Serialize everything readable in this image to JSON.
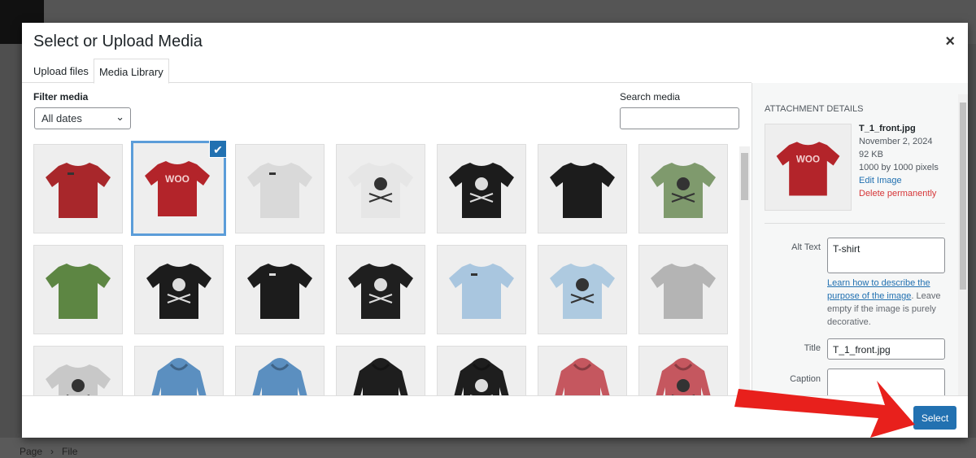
{
  "modal": {
    "title": "Select or Upload Media",
    "close": "×"
  },
  "tabs": [
    {
      "label": "Upload files"
    },
    {
      "label": "Media Library",
      "active": true
    }
  ],
  "filter": {
    "label": "Filter media",
    "value": "All dates"
  },
  "search": {
    "label": "Search media",
    "value": ""
  },
  "grid": [
    {
      "kind": "tee",
      "color": "#a8272b",
      "print": "logo"
    },
    {
      "kind": "tee",
      "color": "#b3242a",
      "print": "woo",
      "selected": true
    },
    {
      "kind": "tee",
      "color": "#d9d9d9",
      "print": "logo"
    },
    {
      "kind": "tee",
      "color": "#e6e6e6",
      "print": "skull"
    },
    {
      "kind": "tee",
      "color": "#1c1c1c",
      "print": "skull"
    },
    {
      "kind": "tee",
      "color": "#1c1c1c",
      "print": "none"
    },
    {
      "kind": "tee",
      "color": "#7f9a6d",
      "print": "skull"
    },
    {
      "kind": "tee",
      "color": "#5d8643",
      "print": "none"
    },
    {
      "kind": "tee",
      "color": "#1c1c1c",
      "print": "skull"
    },
    {
      "kind": "tee",
      "color": "#1c1c1c",
      "print": "logo"
    },
    {
      "kind": "tee",
      "color": "#1f1f1f",
      "print": "skull"
    },
    {
      "kind": "tee",
      "color": "#a9c6df",
      "print": "logo"
    },
    {
      "kind": "tee",
      "color": "#aecae0",
      "print": "skull"
    },
    {
      "kind": "tee",
      "color": "#b4b4b4",
      "print": "none"
    },
    {
      "kind": "tee",
      "color": "#c8c8c8",
      "print": "skull"
    },
    {
      "kind": "hoodie",
      "color": "#5b8fc0",
      "print": "none"
    },
    {
      "kind": "hoodie",
      "color": "#5b8fc0",
      "print": "none"
    },
    {
      "kind": "hoodie",
      "color": "#1e1e1e",
      "print": "none"
    },
    {
      "kind": "hoodie",
      "color": "#1e1e1e",
      "print": "skull"
    },
    {
      "kind": "hoodie",
      "color": "#c5575f",
      "print": "none"
    },
    {
      "kind": "hoodie",
      "color": "#c5575f",
      "print": "skull"
    }
  ],
  "details": {
    "heading": "Attachment Details",
    "filename": "T_1_front.jpg",
    "date": "November 2, 2024",
    "size": "92 KB",
    "dimensions": "1000 by 1000 pixels",
    "edit": "Edit Image",
    "delete": "Delete permanently",
    "alt_label": "Alt Text",
    "alt_value": "T-shirt",
    "help_link": "Learn how to describe the purpose of the image",
    "help_text": ". Leave empty if the image is purely decorative.",
    "title_label": "Title",
    "title_value": "T_1_front.jpg",
    "caption_label": "Caption",
    "caption_value": ""
  },
  "footer": {
    "select": "Select"
  },
  "breadcrumb": [
    "Page",
    "File"
  ],
  "colors": {
    "accent": "#2271b1",
    "delete": "#d63638",
    "arrow": "#e8201c"
  }
}
